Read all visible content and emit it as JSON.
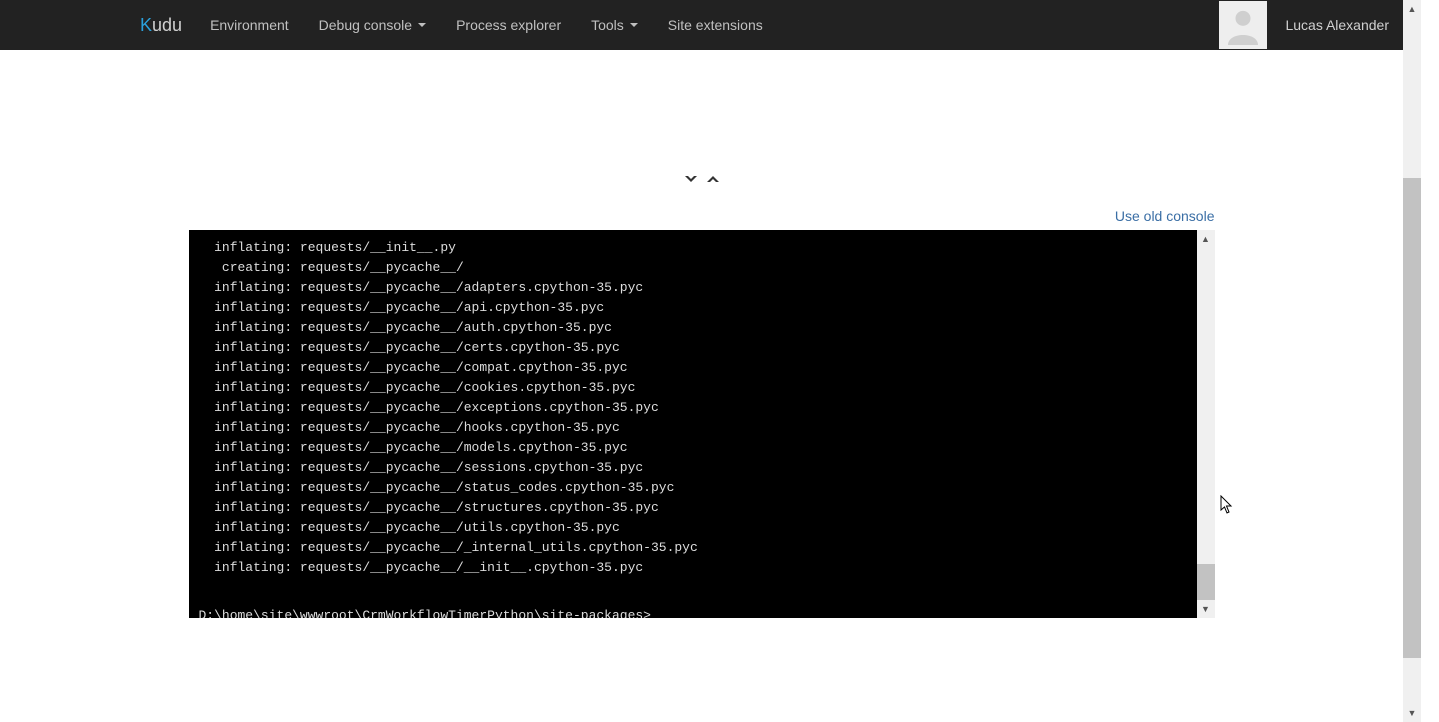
{
  "brand": {
    "k": "K",
    "rest": "udu"
  },
  "nav": {
    "environment": "Environment",
    "debug_console": "Debug console",
    "process_explorer": "Process explorer",
    "tools": "Tools",
    "site_extensions": "Site extensions"
  },
  "user": {
    "name": "Lucas Alexander"
  },
  "console": {
    "old_link": "Use old console",
    "prompt": "D:\\home\\site\\wwwroot\\CrmWorkflowTimerPython\\site-packages>",
    "lines": [
      "  inflating: requests/__init__.py",
      "   creating: requests/__pycache__/",
      "  inflating: requests/__pycache__/adapters.cpython-35.pyc",
      "  inflating: requests/__pycache__/api.cpython-35.pyc",
      "  inflating: requests/__pycache__/auth.cpython-35.pyc",
      "  inflating: requests/__pycache__/certs.cpython-35.pyc",
      "  inflating: requests/__pycache__/compat.cpython-35.pyc",
      "  inflating: requests/__pycache__/cookies.cpython-35.pyc",
      "  inflating: requests/__pycache__/exceptions.cpython-35.pyc",
      "  inflating: requests/__pycache__/hooks.cpython-35.pyc",
      "  inflating: requests/__pycache__/models.cpython-35.pyc",
      "  inflating: requests/__pycache__/sessions.cpython-35.pyc",
      "  inflating: requests/__pycache__/status_codes.cpython-35.pyc",
      "  inflating: requests/__pycache__/structures.cpython-35.pyc",
      "  inflating: requests/__pycache__/utils.cpython-35.pyc",
      "  inflating: requests/__pycache__/_internal_utils.cpython-35.pyc",
      "  inflating: requests/__pycache__/__init__.cpython-35.pyc"
    ]
  }
}
